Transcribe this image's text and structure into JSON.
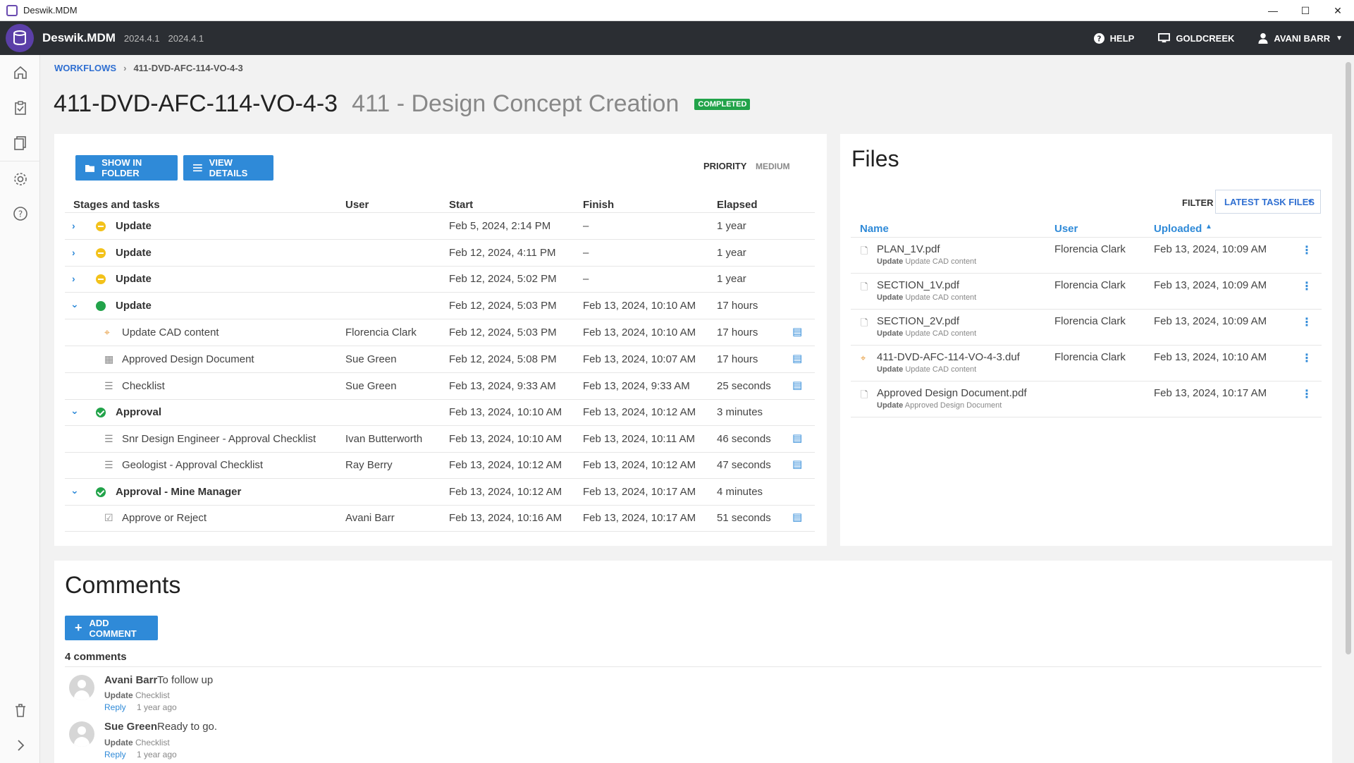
{
  "window": {
    "title": "Deswik.MDM",
    "controls": [
      "—",
      "☐",
      "✕"
    ]
  },
  "appbar": {
    "brand": "Deswik.MDM",
    "version1": "2024.4.1",
    "version2": "2024.4.1",
    "help": "HELP",
    "workspace": "GOLDCREEK",
    "user": "AVANI BARR"
  },
  "breadcrumb": {
    "root": "WORKFLOWS",
    "current": "411-DVD-AFC-114-VO-4-3"
  },
  "page": {
    "id": "411-DVD-AFC-114-VO-4-3",
    "name": "411 - Design Concept Creation",
    "status": "COMPLETED"
  },
  "toolbar": {
    "show_in_folder": "SHOW IN FOLDER",
    "view_details": "VIEW DETAILS",
    "priority_label": "PRIORITY",
    "priority_value": "MEDIUM"
  },
  "stages_header": {
    "stages": "Stages and tasks",
    "user": "User",
    "start": "Start",
    "finish": "Finish",
    "elapsed": "Elapsed"
  },
  "rows": [
    {
      "kind": "stage",
      "expanded": false,
      "status": "pending",
      "name": "Update",
      "user": "",
      "start": "Feb 5, 2024, 2:14 PM",
      "finish": "–",
      "elapsed": "1 year"
    },
    {
      "kind": "stage",
      "expanded": false,
      "status": "pending",
      "name": "Update",
      "user": "",
      "start": "Feb 12, 2024, 4:11 PM",
      "finish": "–",
      "elapsed": "1 year"
    },
    {
      "kind": "stage",
      "expanded": false,
      "status": "pending",
      "name": "Update",
      "user": "",
      "start": "Feb 12, 2024, 5:02 PM",
      "finish": "–",
      "elapsed": "1 year"
    },
    {
      "kind": "stage",
      "expanded": true,
      "status": "done",
      "name": "Update",
      "user": "",
      "start": "Feb 12, 2024, 5:03 PM",
      "finish": "Feb 13, 2024, 10:10 AM",
      "elapsed": "17 hours"
    },
    {
      "kind": "task",
      "icon": "cad",
      "name": "Update CAD content",
      "user": "Florencia Clark",
      "start": "Feb 12, 2024, 5:03 PM",
      "finish": "Feb 13, 2024, 10:10 AM",
      "elapsed": "17 hours"
    },
    {
      "kind": "task",
      "icon": "document",
      "name": "Approved Design Document",
      "user": "Sue Green",
      "start": "Feb 12, 2024, 5:08 PM",
      "finish": "Feb 13, 2024, 10:07 AM",
      "elapsed": "17 hours"
    },
    {
      "kind": "task",
      "icon": "checklist",
      "name": "Checklist",
      "user": "Sue Green",
      "start": "Feb 13, 2024, 9:33 AM",
      "finish": "Feb 13, 2024, 9:33 AM",
      "elapsed": "25 seconds"
    },
    {
      "kind": "stage",
      "expanded": true,
      "status": "approved",
      "name": "Approval",
      "user": "",
      "start": "Feb 13, 2024, 10:10 AM",
      "finish": "Feb 13, 2024, 10:12 AM",
      "elapsed": "3 minutes"
    },
    {
      "kind": "task",
      "icon": "checklist",
      "name": "Snr Design Engineer - Approval Checklist",
      "user": "Ivan Butterworth",
      "start": "Feb 13, 2024, 10:10 AM",
      "finish": "Feb 13, 2024, 10:11 AM",
      "elapsed": "46 seconds"
    },
    {
      "kind": "task",
      "icon": "checklist",
      "name": "Geologist - Approval Checklist",
      "user": "Ray Berry",
      "start": "Feb 13, 2024, 10:12 AM",
      "finish": "Feb 13, 2024, 10:12 AM",
      "elapsed": "47 seconds"
    },
    {
      "kind": "stage",
      "expanded": true,
      "status": "approved",
      "name": "Approval - Mine Manager",
      "user": "",
      "start": "Feb 13, 2024, 10:12 AM",
      "finish": "Feb 13, 2024, 10:17 AM",
      "elapsed": "4 minutes"
    },
    {
      "kind": "task",
      "icon": "checkbox",
      "name": "Approve or Reject",
      "user": "Avani Barr",
      "start": "Feb 13, 2024, 10:16 AM",
      "finish": "Feb 13, 2024, 10:17 AM",
      "elapsed": "51 seconds"
    }
  ],
  "files": {
    "title": "Files",
    "filter_label": "FILTER",
    "filter_value": "LATEST TASK FILES",
    "headers": {
      "name": "Name",
      "user": "User",
      "uploaded": "Uploaded"
    },
    "items": [
      {
        "icon": "file",
        "name": "PLAN_1V.pdf",
        "stage": "Update",
        "task": "Update CAD content",
        "user": "Florencia Clark",
        "uploaded": "Feb 13, 2024, 10:09 AM"
      },
      {
        "icon": "file",
        "name": "SECTION_1V.pdf",
        "stage": "Update",
        "task": "Update CAD content",
        "user": "Florencia Clark",
        "uploaded": "Feb 13, 2024, 10:09 AM"
      },
      {
        "icon": "file",
        "name": "SECTION_2V.pdf",
        "stage": "Update",
        "task": "Update CAD content",
        "user": "Florencia Clark",
        "uploaded": "Feb 13, 2024, 10:09 AM"
      },
      {
        "icon": "cad",
        "name": "411-DVD-AFC-114-VO-4-3.duf",
        "stage": "Update",
        "task": "Update CAD content",
        "user": "Florencia Clark",
        "uploaded": "Feb 13, 2024, 10:10 AM"
      },
      {
        "icon": "file",
        "name": "Approved Design Document.pdf",
        "stage": "Update",
        "task": "Approved Design Document",
        "user": "",
        "uploaded": "Feb 13, 2024, 10:17 AM"
      }
    ]
  },
  "comments": {
    "title": "Comments",
    "add_button": "ADD COMMENT",
    "count": "4 comments",
    "items": [
      {
        "author": "Avani Barr",
        "text": "To follow up",
        "stage": "Update",
        "task": "Checklist",
        "reply": "Reply",
        "time": "1 year ago"
      },
      {
        "author": "Sue Green",
        "text": "Ready to go.",
        "stage": "Update",
        "task": "Checklist",
        "reply": "Reply",
        "time": "1 year ago"
      }
    ]
  },
  "colors": {
    "accent": "#2f8ad8",
    "success": "#22a34a",
    "pending": "#f3c21b",
    "header_bg": "#2b2e33"
  }
}
